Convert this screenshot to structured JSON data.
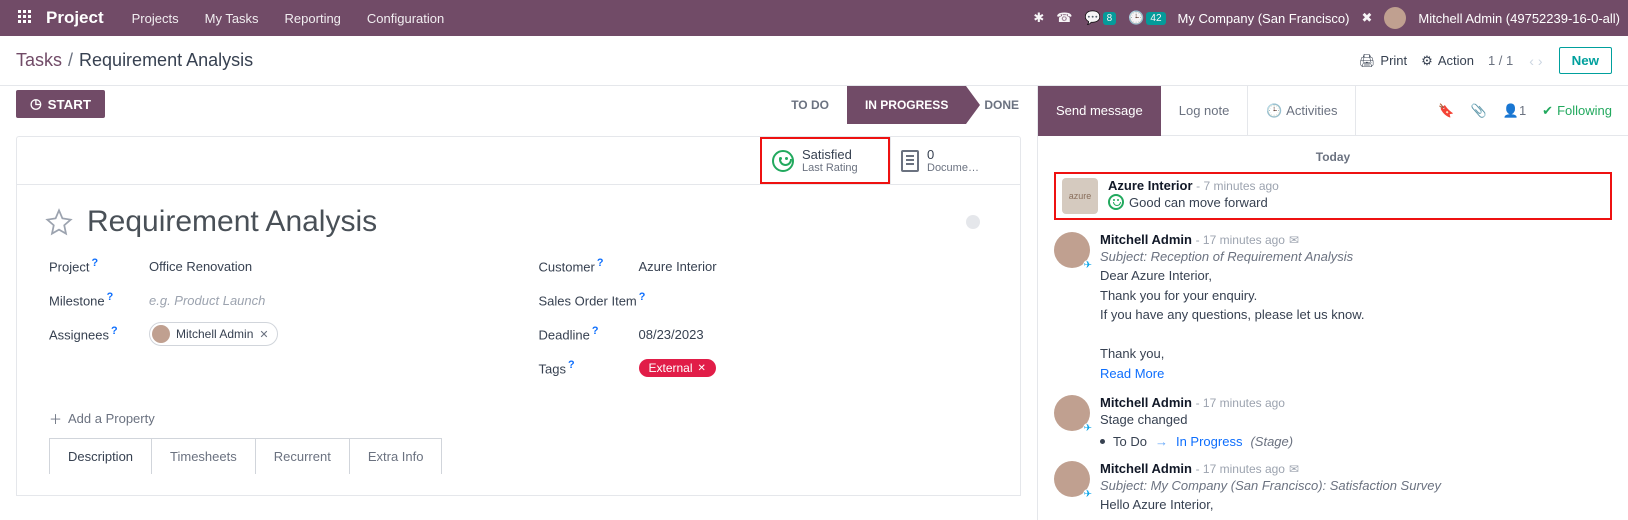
{
  "topbar": {
    "brand": "Project",
    "nav": [
      "Projects",
      "My Tasks",
      "Reporting",
      "Configuration"
    ],
    "msg_badge": "8",
    "clock_badge": "42",
    "company": "My Company (San Francisco)",
    "user": "Mitchell Admin (49752239-16-0-all)"
  },
  "breadcrumb": {
    "root": "Tasks",
    "current": "Requirement Analysis"
  },
  "toolbar": {
    "print": "Print",
    "action": "Action",
    "pager": "1 / 1",
    "new": "New"
  },
  "stages": {
    "start": "START",
    "todo": "TO DO",
    "inprogress": "IN PROGRESS",
    "done": "DONE"
  },
  "stats": {
    "satisfied": "Satisfied",
    "last_rating": "Last Rating",
    "doc_count": "0",
    "documents": "Docume…"
  },
  "title": "Requirement Analysis",
  "fields": {
    "project_label": "Project",
    "project_val": "Office Renovation",
    "milestone_label": "Milestone",
    "milestone_ph": "e.g. Product Launch",
    "assignees_label": "Assignees",
    "assignee": "Mitchell Admin",
    "customer_label": "Customer",
    "customer_val": "Azure Interior",
    "soi_label": "Sales Order Item",
    "deadline_label": "Deadline",
    "deadline_val": "08/23/2023",
    "tags_label": "Tags",
    "tag_val": "External",
    "add_prop": "Add a Property"
  },
  "tabs": [
    "Description",
    "Timesheets",
    "Recurrent",
    "Extra Info"
  ],
  "msgbar": {
    "send": "Send message",
    "log": "Log note",
    "activities": "Activities",
    "followers": "1",
    "following": "Following"
  },
  "chat": {
    "today": "Today",
    "m1": {
      "author": "Azure Interior",
      "time": "- 7 minutes ago",
      "body": "Good can move forward"
    },
    "m2": {
      "author": "Mitchell Admin",
      "time": "- 17 minutes ago",
      "subj": "Subject: Reception of Requirement Analysis",
      "l1": "Dear Azure Interior,",
      "l2": "Thank you for your enquiry.",
      "l3": "If you have any questions, please let us know.",
      "l4": "Thank you,",
      "read": "Read More"
    },
    "m3": {
      "author": "Mitchell Admin",
      "time": "- 17 minutes ago",
      "body": "Stage changed",
      "from": "To Do",
      "to": "In Progress",
      "field": "(Stage)"
    },
    "m4": {
      "author": "Mitchell Admin",
      "time": "- 17 minutes ago",
      "subj": "Subject: My Company (San Francisco): Satisfaction Survey",
      "l1": "Hello Azure Interior,"
    }
  }
}
